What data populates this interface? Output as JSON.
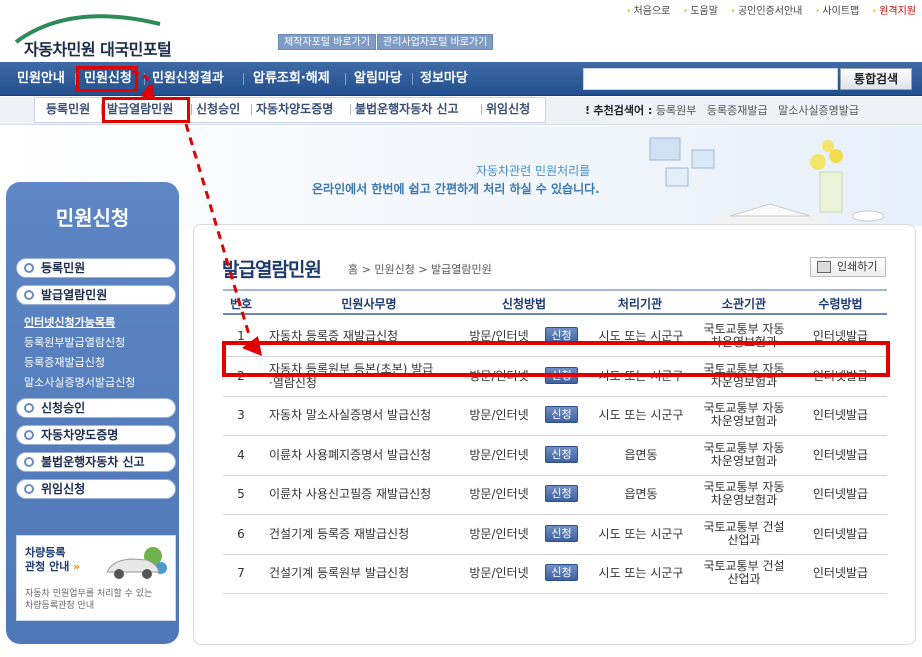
{
  "site": {
    "logo_text": "자동차민원 대국민포털",
    "portal_buttons": [
      "제작자포털 바로가기",
      "관리사업자포털 바로가기"
    ],
    "util_links": [
      "처음으로",
      "도움말",
      "공인인증서안내",
      "사이트맵",
      "원격지원"
    ]
  },
  "gnb": {
    "items": [
      "민원안내",
      "민원신청",
      "민원신청결과",
      "압류조회·해제",
      "알림마당",
      "정보마당"
    ],
    "search_placeholder": "",
    "search_button": "통합검색"
  },
  "snb": {
    "items": [
      "등록민원",
      "발급열람민원",
      "신청승인",
      "자동차양도증명",
      "불법운행자동차 신고",
      "위임신청"
    ],
    "recommend_label": "추천검색어 :",
    "recommend_items": [
      "등록원부",
      "등록증재발급",
      "말소사실증명발급"
    ]
  },
  "hero": {
    "line1": "자동차관련 민원처리를",
    "line2": "온라인에서 한번에 쉽고 간편하게 처리 하실 수 있습니다."
  },
  "side": {
    "title": "민원신청",
    "menu": [
      "등록민원",
      "발급열람민원",
      "신청승인",
      "자동차양도증명",
      "불법운행자동차 신고",
      "위임신청"
    ],
    "submenu": [
      "인터넷신청가능목록",
      "등록원부발급열람신청",
      "등록증재발급신청",
      "말소사실증명서발급신청"
    ],
    "banner_title_line1": "차량등록",
    "banner_title_line2": "관청 안내",
    "banner_sub_line1": "자동차 민원업무를 처리할 수 있는",
    "banner_sub_line2": "차량등록관청 안내"
  },
  "main": {
    "title": "발급열람민원",
    "breadcrumb": [
      "홈",
      "민원신청",
      "발급열람민원"
    ],
    "print_button": "인쇄하기",
    "headers": [
      "번호",
      "민원사무명",
      "신청방법",
      "처리기관",
      "소관기관",
      "수령방법"
    ],
    "apply_label": "신청",
    "rows": [
      {
        "no": "1",
        "name1": "자동차 등록증 재발급신청",
        "name2": "",
        "method": "방문/인터넷",
        "proc": "시도 또는 시군구",
        "org1": "국토교통부 자동",
        "org2": "차운영보험과",
        "recv": "인터넷발급"
      },
      {
        "no": "2",
        "name1": "자동차 등록원부 등본(초본) 발급",
        "name2": "·열람신청",
        "method": "방문/인터넷",
        "proc": "시도 또는 시군구",
        "org1": "국토교통부 자동",
        "org2": "차운영보험과",
        "recv": "인터넷발급"
      },
      {
        "no": "3",
        "name1": "자동차 말소사실증명서 발급신청",
        "name2": "",
        "method": "방문/인터넷",
        "proc": "시도 또는 시군구",
        "org1": "국토교통부 자동",
        "org2": "차운영보험과",
        "recv": "인터넷발급"
      },
      {
        "no": "4",
        "name1": "이륜차 사용폐지증명서 발급신청",
        "name2": "",
        "method": "방문/인터넷",
        "proc": "읍면동",
        "org1": "국토교통부 자동",
        "org2": "차운영보험과",
        "recv": "인터넷발급"
      },
      {
        "no": "5",
        "name1": "이륜차 사용신고필증 재발급신청",
        "name2": "",
        "method": "방문/인터넷",
        "proc": "읍면동",
        "org1": "국토교통부 자동",
        "org2": "차운영보험과",
        "recv": "인터넷발급"
      },
      {
        "no": "6",
        "name1": "건설기계 등록증 재발급신청",
        "name2": "",
        "method": "방문/인터넷",
        "proc": "시도 또는 시군구",
        "org1": "국토교통부 건설",
        "org2": "산업과",
        "recv": "인터넷발급"
      },
      {
        "no": "7",
        "name1": "건설기계 등록원부 발급신청",
        "name2": "",
        "method": "방문/인터넷",
        "proc": "시도 또는 시군구",
        "org1": "국토교통부 건설",
        "org2": "산업과",
        "recv": "인터넷발급"
      }
    ]
  },
  "colors": {
    "highlight": "#e00000",
    "nav": "#2b5795",
    "accent": "#1e3a6e"
  }
}
